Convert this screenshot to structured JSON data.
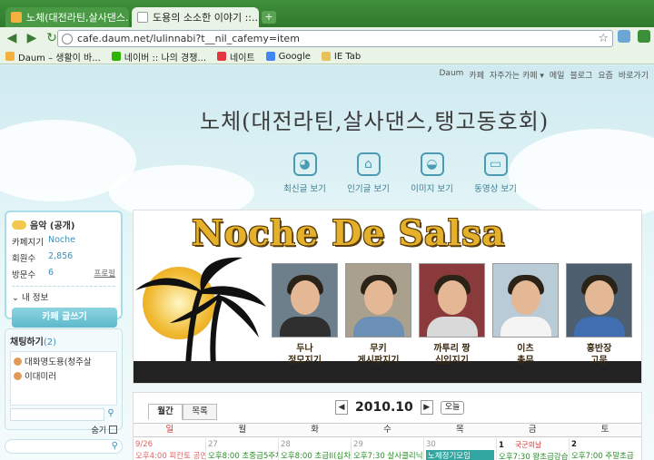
{
  "browser": {
    "tabs": [
      {
        "label": "노체(대전라틴,살사댄스...",
        "active": false
      },
      {
        "label": "도용의 소소한 이야기 ::...",
        "active": true
      }
    ],
    "url": "cafe.daum.net/lulinnabi?t__nil_cafemy=item",
    "bookmarks": [
      "Daum – 생활이 바...",
      "네이버 :: 나의 경쟁...",
      "네이트",
      "Google",
      "IE Tab"
    ]
  },
  "topnav": [
    "Daum",
    "카페",
    "자주가는 카페 ▾",
    "메일",
    "블로그",
    "요즘",
    "바로가기"
  ],
  "cafe_title": "노체(대전라틴,살사댄스,탱고동호회)",
  "menu": [
    {
      "icon": "dog-icon",
      "label": "최신글 보기"
    },
    {
      "icon": "house-icon",
      "label": "인기글 보기"
    },
    {
      "icon": "hat-icon",
      "label": "이미지 보기"
    },
    {
      "icon": "car-icon",
      "label": "동영상 보기"
    }
  ],
  "sidebar": {
    "title": "음악 (공개)",
    "rows": [
      {
        "key": "카페지기",
        "value": "Noche"
      },
      {
        "key": "회원수",
        "value": "2,856"
      },
      {
        "key": "방문수",
        "value": "6",
        "extra": "프로필"
      }
    ],
    "my_info": "내 정보",
    "write_button": "카페 글쓰기"
  },
  "chat": {
    "title": "채팅하기",
    "count": "(2)",
    "users": [
      "대화명도용(청주살",
      "이대미러"
    ],
    "hide_label": "숨기"
  },
  "banner": {
    "title": "Noche De Salsa",
    "people": [
      {
        "name": "두나",
        "role": "정모지기",
        "shirt": "#2f2f2f"
      },
      {
        "name": "무키",
        "role": "게시판지기",
        "shirt": "#6b8fb5"
      },
      {
        "name": "까투리 짱",
        "role": "신입지기",
        "shirt": "#d9d9d9"
      },
      {
        "name": "이츠",
        "role": "총무",
        "shirt": "#f4f4f4"
      },
      {
        "name": "홍반장",
        "role": "고문",
        "shirt": "#3f6fb0"
      }
    ]
  },
  "calendar": {
    "tabs": [
      "월간",
      "목록"
    ],
    "month": "2010.10",
    "today_label": "오늘",
    "weekdays": [
      "일",
      "월",
      "화",
      "수",
      "목",
      "금",
      "토"
    ],
    "cells": [
      {
        "day": "9/26",
        "event": "오후4:00 피칸토 공연"
      },
      {
        "day": "27",
        "event": "오후8:00 초중급5주차"
      },
      {
        "day": "28",
        "event": "오후8:00 초급II(십차"
      },
      {
        "day": "29",
        "event": "오후7:30 살사클리닉"
      },
      {
        "day": "30",
        "event": "노체정기모임"
      },
      {
        "day": "1",
        "holiday": "국군의날",
        "event": "오후7:30 왕초급강습"
      },
      {
        "day": "2",
        "event": "오후7:00 주말초급"
      }
    ]
  },
  "colors": {
    "accent": "#4d9bb3",
    "chrome": "#3f8f3c",
    "highlight": "#32a6a0"
  }
}
